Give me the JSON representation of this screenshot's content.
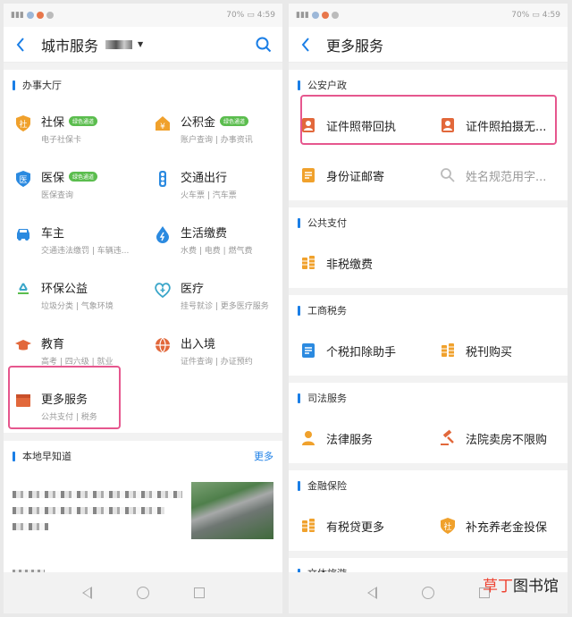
{
  "status": {
    "time": "4:59",
    "battery": "70%"
  },
  "left": {
    "title": "城市服务",
    "section1": "办事大厅",
    "services": [
      {
        "title": "社保",
        "badge": "绿色通道",
        "sub": "电子社保卡",
        "icon": "social-security-icon"
      },
      {
        "title": "公积金",
        "badge": "绿色通道",
        "sub": "账户查询 | 办事资讯",
        "icon": "housing-fund-icon"
      },
      {
        "title": "医保",
        "badge": "绿色通道",
        "sub": "医保查询",
        "icon": "medical-insurance-icon"
      },
      {
        "title": "交通出行",
        "badge": "",
        "sub": "火车票 | 汽车票",
        "icon": "traffic-light-icon"
      },
      {
        "title": "车主",
        "badge": "",
        "sub": "交通违法缴罚 | 车辆违...",
        "icon": "car-icon"
      },
      {
        "title": "生活缴费",
        "badge": "",
        "sub": "水费 | 电费 | 燃气费",
        "icon": "utility-bill-icon"
      },
      {
        "title": "环保公益",
        "badge": "",
        "sub": "垃圾分类 | 气象环境",
        "icon": "recycle-icon"
      },
      {
        "title": "医疗",
        "badge": "",
        "sub": "挂号就诊 | 更多医疗服务",
        "icon": "medical-icon"
      },
      {
        "title": "教育",
        "badge": "",
        "sub": "高考 | 四六级 | 就业",
        "icon": "graduation-cap-icon"
      },
      {
        "title": "出入境",
        "badge": "",
        "sub": "证件查询 | 办证预约",
        "icon": "globe-icon"
      },
      {
        "title": "更多服务",
        "badge": "",
        "sub": "公共支付 | 税务",
        "icon": "more-box-icon"
      }
    ],
    "section2": "本地早知道",
    "more": "更多"
  },
  "right": {
    "title": "更多服务",
    "sections": [
      {
        "head": "公安户政",
        "rows": [
          [
            {
              "label": "证件照带回执",
              "icon": "id-photo-icon"
            },
            {
              "label": "证件照拍摄无...",
              "icon": "id-photo-icon"
            }
          ],
          [
            {
              "label": "身份证邮寄",
              "icon": "id-card-mail-icon"
            },
            {
              "label": "姓名规范用字...",
              "icon": "name-search-icon"
            }
          ]
        ]
      },
      {
        "head": "公共支付",
        "rows": [
          [
            {
              "label": "非税缴费",
              "icon": "coins-icon"
            }
          ]
        ]
      },
      {
        "head": "工商税务",
        "rows": [
          [
            {
              "label": "个税扣除助手",
              "icon": "tax-doc-icon"
            },
            {
              "label": "税刊购买",
              "icon": "coins-icon"
            }
          ]
        ]
      },
      {
        "head": "司法服务",
        "rows": [
          [
            {
              "label": "法律服务",
              "icon": "lawyer-icon"
            },
            {
              "label": "法院卖房不限购",
              "icon": "gavel-icon"
            }
          ]
        ]
      },
      {
        "head": "金融保险",
        "rows": [
          [
            {
              "label": "有税贷更多",
              "icon": "coins-icon"
            },
            {
              "label": "补充养老金投保",
              "icon": "pension-icon"
            }
          ]
        ]
      },
      {
        "head": "文体旅游",
        "rows": []
      }
    ]
  },
  "watermark": {
    "part1": "草丁",
    "part2": "图书馆"
  }
}
